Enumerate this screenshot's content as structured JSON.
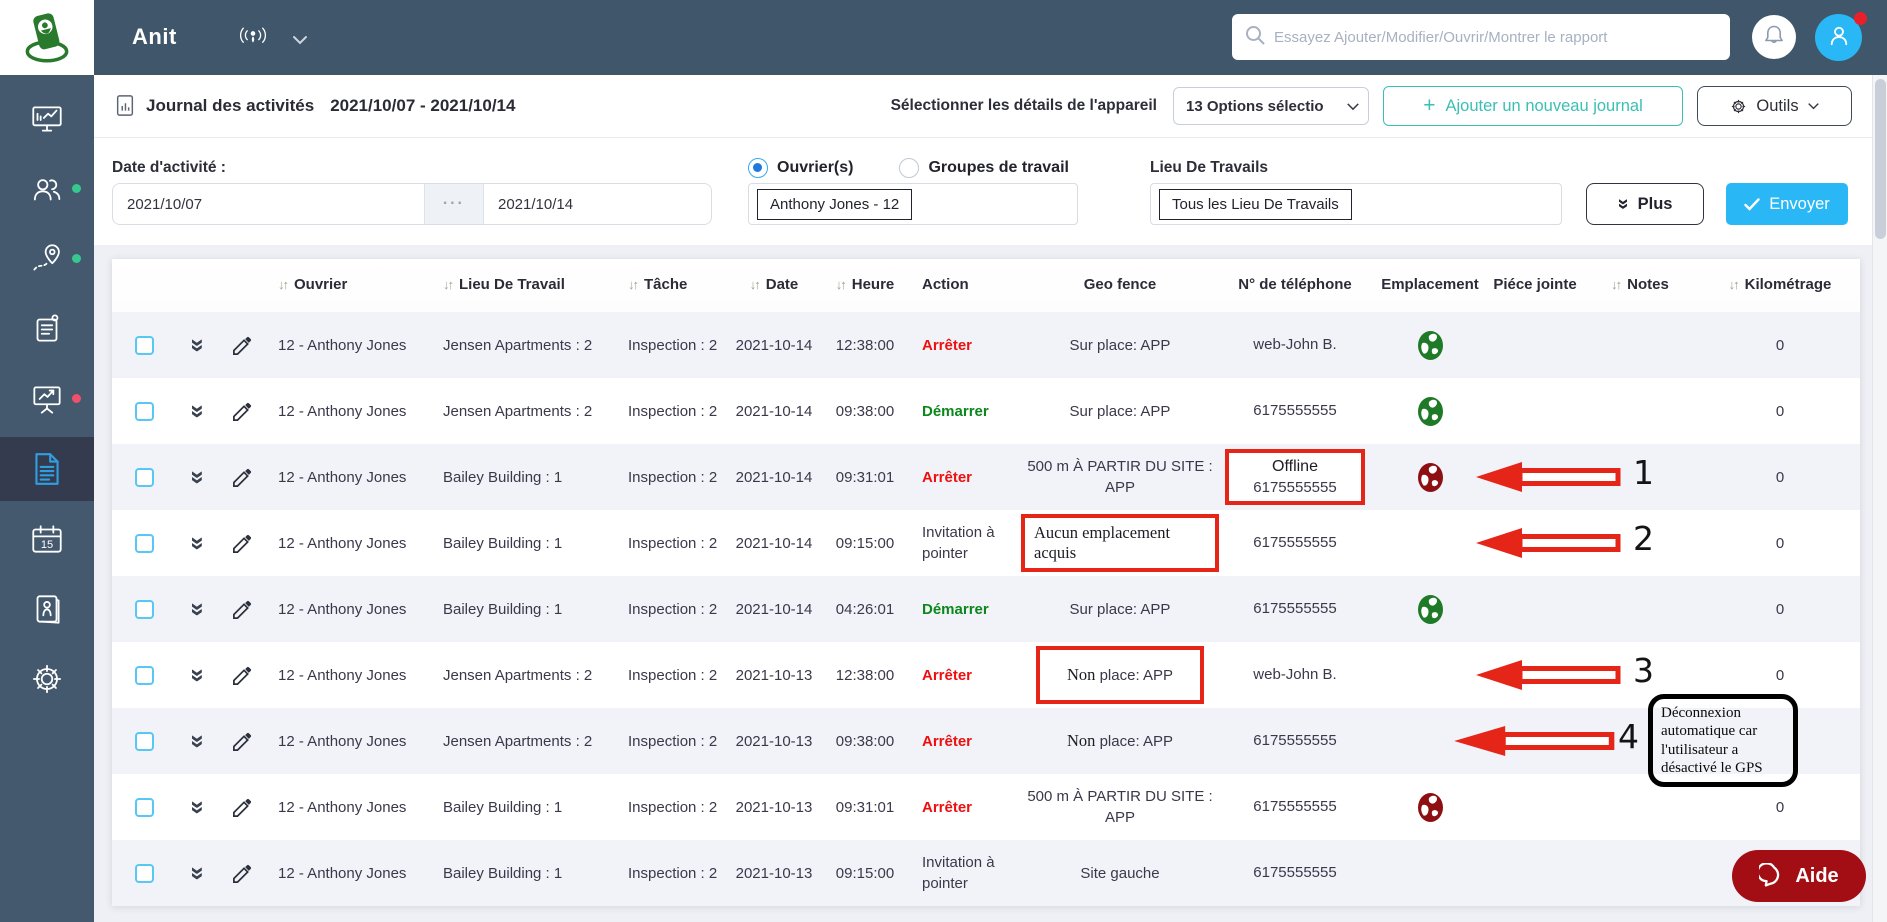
{
  "header": {
    "brand": "Anit",
    "search_placeholder": "Essayez Ajouter/Modifier/Ouvrir/Montrer le rapport"
  },
  "sidebar": {
    "items": [
      {
        "icon": "dashboard",
        "badge": null,
        "active": false
      },
      {
        "icon": "users",
        "badge": "green",
        "active": false
      },
      {
        "icon": "map",
        "badge": "green",
        "active": false
      },
      {
        "icon": "notes",
        "badge": null,
        "active": false
      },
      {
        "icon": "board",
        "badge": "red",
        "active": false
      },
      {
        "icon": "journal",
        "badge": null,
        "active": true
      },
      {
        "icon": "calendar",
        "badge": null,
        "active": false,
        "day": "15"
      },
      {
        "icon": "handbook",
        "badge": null,
        "active": false
      },
      {
        "icon": "settings",
        "badge": null,
        "active": false
      }
    ]
  },
  "title_bar": {
    "title": "Journal des activités",
    "date_range": "2021/10/07 - 2021/10/14",
    "device_label": "Sélectionner les détails de l'appareil",
    "options_select": "13 Options sélectio",
    "add_journal": "Ajouter un nouveau journal",
    "add_plus": "+",
    "tools": "Outils"
  },
  "filters": {
    "date_label": "Date d'activité :",
    "date_from": "2021/10/07",
    "date_to": "2021/10/14",
    "date_sep": "···",
    "radio_workers": "Ouvrier(s)",
    "radio_groups": "Groupes de travail",
    "worker_chip": "Anthony Jones - 12",
    "site_label": "Lieu De Travails",
    "site_chip": "Tous les Lieu De Travails",
    "plus": "Plus",
    "send": "Envoyer"
  },
  "table": {
    "columns": [
      {
        "label": "Ouvrier",
        "sort": true
      },
      {
        "label": "Lieu De Travail",
        "sort": true
      },
      {
        "label": "Tâche",
        "sort": true
      },
      {
        "label": "Date",
        "sort": true
      },
      {
        "label": "Heure",
        "sort": true
      },
      {
        "label": "Action",
        "sort": false
      },
      {
        "label": "Geo fence",
        "sort": false
      },
      {
        "label": "N° de téléphone",
        "sort": false
      },
      {
        "label": "Emplacement",
        "sort": false
      },
      {
        "label": "Piéce jointe",
        "sort": false
      },
      {
        "label": "Notes",
        "sort": true
      },
      {
        "label": "Kilométrage",
        "sort": true
      }
    ],
    "sort_glyph": "↓↑"
  },
  "rows": [
    {
      "worker": "12 - Anthony Jones",
      "site": "Jensen Apartments : 2",
      "task": "Inspection : 2",
      "date": "2021-10-14",
      "time": "12:38:00",
      "action": "Arrêter",
      "action_type": "stop",
      "geo": "Sur place: APP",
      "geo_style": "plain",
      "geo_boxed": false,
      "phone": [
        "web-John B."
      ],
      "phone_boxed": false,
      "globe": "green",
      "arrow": null,
      "note": false,
      "km": "0"
    },
    {
      "worker": "12 - Anthony Jones",
      "site": "Jensen Apartments : 2",
      "task": "Inspection : 2",
      "date": "2021-10-14",
      "time": "09:38:00",
      "action": "Démarrer",
      "action_type": "start",
      "geo": "Sur place: APP",
      "geo_style": "plain",
      "geo_boxed": false,
      "phone": [
        "6175555555"
      ],
      "phone_boxed": false,
      "globe": "green",
      "arrow": null,
      "note": false,
      "km": "0"
    },
    {
      "worker": "12 - Anthony Jones",
      "site": "Bailey Building : 1",
      "task": "Inspection : 2",
      "date": "2021-10-14",
      "time": "09:31:01",
      "action": "Arrêter",
      "action_type": "stop",
      "geo": "500 m À PARTIR DU SITE : APP",
      "geo_style": "plain",
      "geo_boxed": false,
      "phone": [
        "Offline",
        "6175555555"
      ],
      "phone_boxed": true,
      "globe": "red",
      "arrow": "1",
      "note": false,
      "km": "0"
    },
    {
      "worker": "12 - Anthony Jones",
      "site": "Bailey Building : 1",
      "task": "Inspection : 2",
      "date": "2021-10-14",
      "time": "09:15:00",
      "action": "Invitation à pointer",
      "action_type": "invite",
      "geo": "Aucun emplacement acquis",
      "geo_style": "serif",
      "geo_boxed": true,
      "phone": [
        "6175555555"
      ],
      "phone_boxed": false,
      "globe": null,
      "arrow": "2",
      "note": false,
      "km": "0"
    },
    {
      "worker": "12 - Anthony Jones",
      "site": "Bailey Building : 1",
      "task": "Inspection : 2",
      "date": "2021-10-14",
      "time": "04:26:01",
      "action": "Démarrer",
      "action_type": "start",
      "geo": "Sur place: APP",
      "geo_style": "plain",
      "geo_boxed": false,
      "phone": [
        "6175555555"
      ],
      "phone_boxed": false,
      "globe": "green",
      "arrow": null,
      "note": false,
      "km": "0"
    },
    {
      "worker": "12 - Anthony Jones",
      "site": "Jensen Apartments : 2",
      "task": "Inspection : 2",
      "date": "2021-10-13",
      "time": "12:38:00",
      "action": "Arrêter",
      "action_type": "stop",
      "geo_serif": "Non",
      "geo_rest": " place: APP",
      "geo_style": "mixed",
      "geo_boxed": true,
      "phone": [
        "web-John B."
      ],
      "phone_boxed": false,
      "globe": null,
      "arrow": "3",
      "note": false,
      "km": "0"
    },
    {
      "worker": "12 - Anthony Jones",
      "site": "Jensen Apartments : 2",
      "task": "Inspection : 2",
      "date": "2021-10-13",
      "time": "09:38:00",
      "action": "Arrêter",
      "action_type": "stop",
      "geo_serif": "Non",
      "geo_rest": " place: APP",
      "geo_style": "mixed",
      "geo_boxed": false,
      "phone": [
        "6175555555"
      ],
      "phone_boxed": false,
      "globe": null,
      "arrow": "4",
      "note": true,
      "km": ""
    },
    {
      "worker": "12 - Anthony Jones",
      "site": "Bailey Building : 1",
      "task": "Inspection : 2",
      "date": "2021-10-13",
      "time": "09:31:01",
      "action": "Arrêter",
      "action_type": "stop",
      "geo": "500 m À PARTIR DU SITE : APP",
      "geo_style": "plain",
      "geo_boxed": false,
      "phone": [
        "6175555555"
      ],
      "phone_boxed": false,
      "globe": "red",
      "arrow": null,
      "note": false,
      "km": "0"
    },
    {
      "worker": "12 - Anthony Jones",
      "site": "Bailey Building : 1",
      "task": "Inspection : 2",
      "date": "2021-10-13",
      "time": "09:15:00",
      "action": "Invitation à pointer",
      "action_type": "invite",
      "geo": "Site gauche",
      "geo_style": "plain",
      "geo_boxed": false,
      "phone": [
        "6175555555"
      ],
      "phone_boxed": false,
      "globe": null,
      "arrow": null,
      "note": false,
      "km": ""
    }
  ],
  "annotations": {
    "gps_note": "Déconnexion automatique car l'utilisateur a désactivé le GPS",
    "arrow_numbers": [
      "1",
      "2",
      "3",
      "4"
    ]
  },
  "help": {
    "label": "Aide"
  },
  "colors": {
    "header_bg": "#40566a",
    "sidebar_bg": "#44596d",
    "accent_teal": "#3bbfb2",
    "primary_blue": "#2ab7f5",
    "action_red": "#ee0f0f",
    "action_green": "#0c871c",
    "annotation_red": "#e52517",
    "globe_green": "#1f7a28",
    "globe_red": "#8e0f12",
    "help_red": "#a30e15"
  }
}
